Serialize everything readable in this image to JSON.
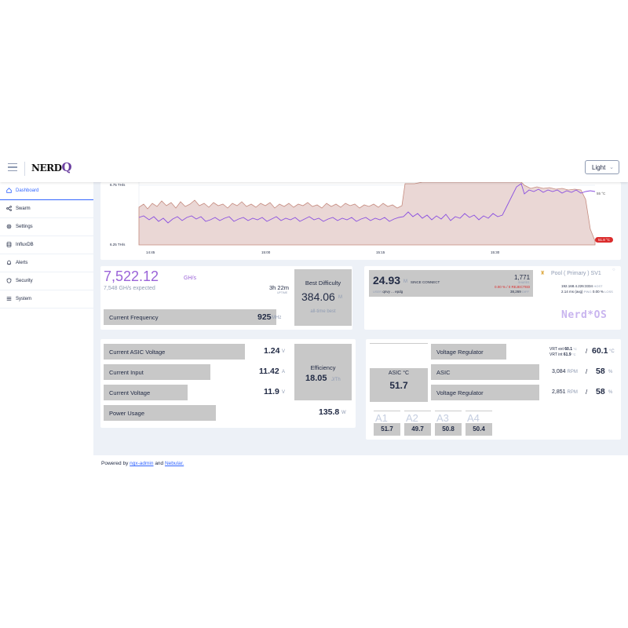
{
  "header": {
    "logo": "NERD",
    "logo_q": "Q",
    "theme": "Light"
  },
  "sidebar": {
    "items": [
      {
        "label": "Dashboard",
        "icon": "home-icon"
      },
      {
        "label": "Swarm",
        "icon": "share-icon"
      },
      {
        "label": "Settings",
        "icon": "gear-icon"
      },
      {
        "label": "InfluxDB",
        "icon": "database-icon"
      },
      {
        "label": "Alerts",
        "icon": "bell-icon"
      },
      {
        "label": "Security",
        "icon": "shield-icon"
      },
      {
        "label": "System",
        "icon": "list-icon"
      }
    ]
  },
  "chart": {
    "y_ticks": [
      "6.75 TH/s",
      "6.25 TH/s"
    ],
    "x_ticks": [
      "14:45",
      "15:00",
      "15:15",
      "15:30"
    ],
    "temp_tick": "55 °C",
    "temp_current": "51.8 °C"
  },
  "chart_data": {
    "type": "line",
    "x": [
      "14:45",
      "15:00",
      "15:15",
      "15:30"
    ],
    "series": [],
    "ylim_labels": [
      "6.25 TH/s",
      "6.75 TH/s"
    ],
    "temp_tick": "55 °C",
    "temp_current": "51.8 °C"
  },
  "hashrate": {
    "value": "7,522.12",
    "unit": "GH/s",
    "expected": "7,548",
    "expected_unit": "GH/s",
    "expected_label": "expected",
    "uptime": "3h 22m",
    "uptime_label": "UPTIME",
    "best_label": "Best Difficulty",
    "best_value": "384.06",
    "best_unit": "M",
    "best_sub": "all-time best",
    "freq_label": "Current Frequency",
    "freq_value": "925",
    "freq_unit": "MHz"
  },
  "pool": {
    "diff": "24.93",
    "diff_unit": "M",
    "since": "SINCE CONNECT",
    "user_label": "USER",
    "user": "qnvy ... epdg",
    "shares": "1,771",
    "shares_label": "SHARES",
    "rejected": "0.00 % / 0 REJECTED",
    "diff_value": "38,269",
    "diff_label": "DIFF",
    "title": "Pool ( Primary ) SV1",
    "host": "192.168.4.226:3334",
    "host_label": "HOST",
    "ping": "2.14 ms (avg)",
    "ping_label": "PING",
    "loss": "0.00 %",
    "loss_label": "LOSS",
    "brand": "Nerd*OS"
  },
  "power": {
    "rows": [
      {
        "label": "Current ASIC Voltage",
        "value": "1.24",
        "unit": "V"
      },
      {
        "label": "Current Input",
        "value": "11.42",
        "unit": "A"
      },
      {
        "label": "Current Voltage",
        "value": "11.9",
        "unit": "V"
      },
      {
        "label": "Power Usage",
        "value": "135.8",
        "unit": "W"
      }
    ],
    "eff_label": "Efficiency",
    "eff_value": "18.05",
    "eff_unit": "J/Th"
  },
  "thermal": {
    "asic_label": "ASIC °C",
    "asic_value": "51.7",
    "vr1_label": "Voltage Regulator",
    "asic_fan_label": "ASIC",
    "vr2_label": "Voltage Regulator",
    "vrt_ext": "VRT ext",
    "vrt_ext_val": "60.1",
    "vrt_int": "VRT int",
    "vrt_int_val": "61.9",
    "vrt_unit": "°C",
    "vrt_main": "60.1",
    "vrt_main_unit": "°C",
    "fan1_rpm": "3,084",
    "fan1_pct": "58",
    "fan2_rpm": "2,851",
    "fan2_pct": "58",
    "rpm_unit": "RPM",
    "pct_unit": "%",
    "chips": [
      {
        "name": "A1",
        "value": "51.7"
      },
      {
        "name": "A2",
        "value": "49.7"
      },
      {
        "name": "A3",
        "value": "50.8"
      },
      {
        "name": "A4",
        "value": "50.4"
      }
    ]
  },
  "footer": {
    "prefix": "Powered by",
    "link1": "ngx-admin",
    "and": "and",
    "link2": "Nebular."
  }
}
